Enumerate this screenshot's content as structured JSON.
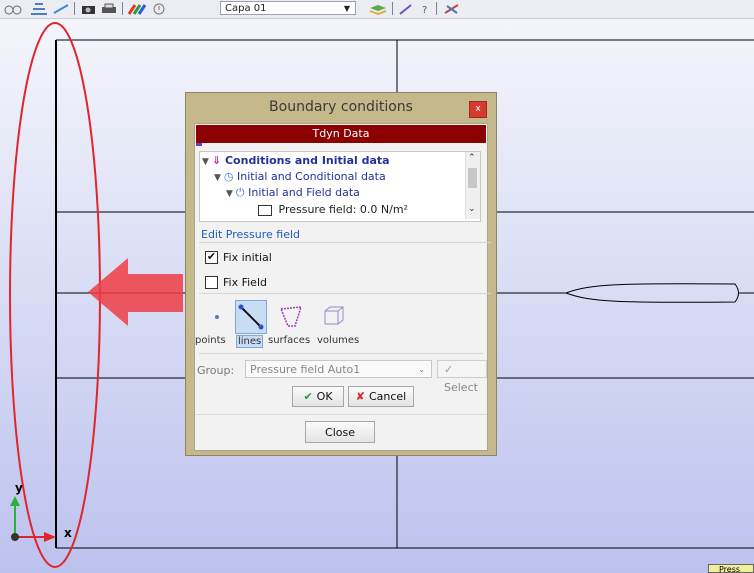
{
  "toolbar": {
    "layer_value": "Capa 01",
    "icons": [
      "mesh-view-icon",
      "grid-icon",
      "camera-icon",
      "printer-icon",
      "color-palette-icon",
      "help-pointer-icon",
      "layers-icon",
      "edit-icon",
      "info-icon",
      "tool-icon"
    ]
  },
  "dialog": {
    "title": "Boundary conditions",
    "close_glyph": "x",
    "header": "Tdyn Data",
    "tree": [
      {
        "label": "Conditions and Initial data",
        "level": 0
      },
      {
        "label": "Initial and Conditional data",
        "level": 1
      },
      {
        "label": "Initial and Field data",
        "level": 2
      },
      {
        "label": "Pressure field: 0.0 N/m²",
        "level": 3
      }
    ],
    "edit_title": "Edit Pressure field",
    "fix_initial": {
      "label": "Fix initial",
      "checked": true
    },
    "fix_field": {
      "label": "Fix Field",
      "checked": false
    },
    "entities": [
      {
        "label": "points",
        "active": false
      },
      {
        "label": "lines",
        "active": true
      },
      {
        "label": "surfaces",
        "active": false
      },
      {
        "label": "volumes",
        "active": false
      }
    ],
    "group_label": "Group:",
    "group_value": "Pressure field Auto1",
    "select_label": "Select",
    "ok_label": "OK",
    "cancel_label": "Cancel",
    "close_label": "Close"
  },
  "axes": {
    "x": "x",
    "y": "y"
  },
  "status_tab": "Press",
  "colors": {
    "dialog_frame": "#c5b98b",
    "header": "#8b0101",
    "annotation": "#e0262c"
  }
}
